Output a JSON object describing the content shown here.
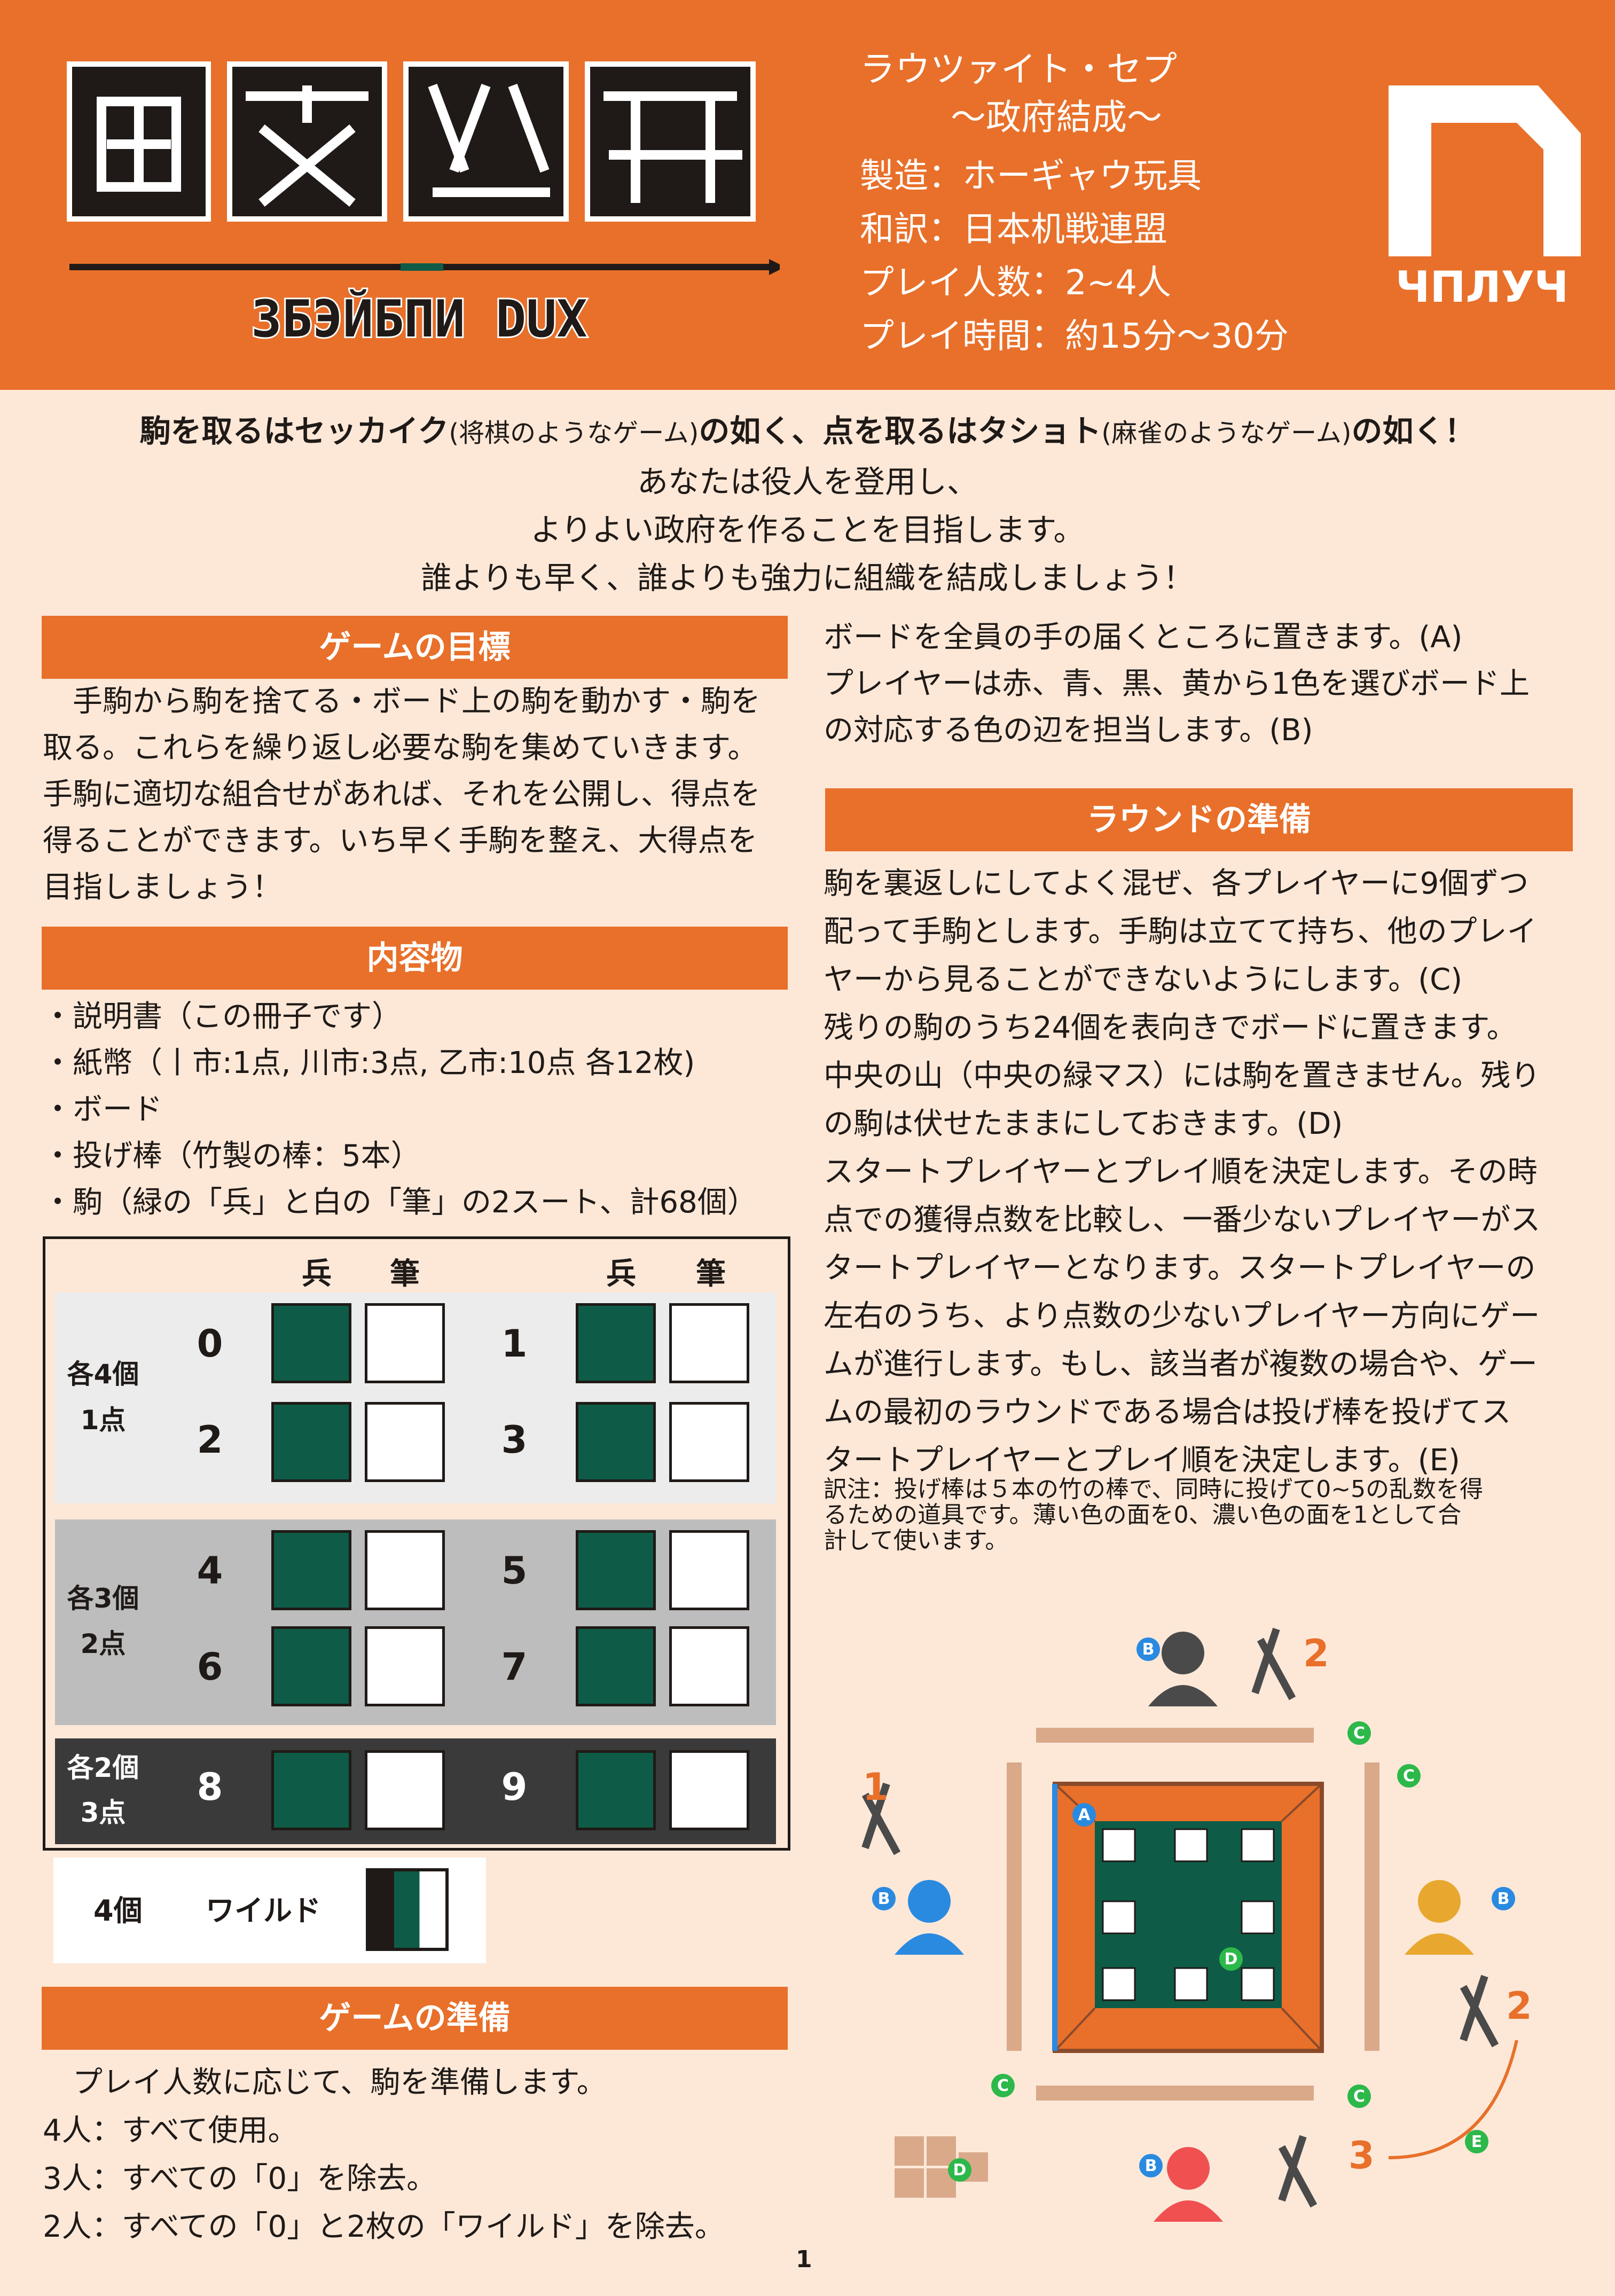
{
  "header": {
    "logo_subtitle": "ЗБЭЙБПИ DUX",
    "title_line1": "ラウツァイト・セプ",
    "title_line2": "〜政府結成〜",
    "manufacturer": "製造：ホーギャウ玩具",
    "translator": "和訳：日本机戦連盟",
    "players": "プレイ人数：2~4人",
    "playtime": "プレイ時間：約15分〜30分",
    "brand_text": "ЧΠЛУЧ"
  },
  "intro": {
    "line1_a": "駒を取るはセッカイク",
    "line1_b": "(将棋のようなゲーム)",
    "line1_c": "の如く、点を取るはタショト",
    "line1_d": "(麻雀のようなゲーム)",
    "line1_e": "の如く！",
    "line2": "あなたは役人を登用し、",
    "line3": "よりよい政府を作ることを目指します。",
    "line4": "誰よりも早く、誰よりも強力に組織を結成しましょう！"
  },
  "left": {
    "goal_title": "ゲームの目標",
    "goal_lines": [
      "　手駒から駒を捨てる・ボード上の駒を動かす・駒を",
      "取る。これらを繰り返し必要な駒を集めていきます。",
      "手駒に適切な組合せがあれば、それを公開し、得点を",
      "得ることができます。いち早く手駒を整え、大得点を",
      "目指しましょう！"
    ],
    "contents_title": "内容物",
    "contents_items": [
      "・説明書（この冊子です）",
      "・紙幣（丨市:1点, 川市:3点, 乙市:10点 各12枚)",
      "・ボード",
      "・投げ棒（竹製の棒：5本）",
      "・駒（緑の「兵」と白の「筆」の2スート、計68個）"
    ],
    "prep_title": "ゲームの準備",
    "prep_lines": [
      "　プレイ人数に応じて、駒を準備します。",
      "4人：すべて使用。",
      "3人：すべての「0」を除去。",
      "2人：すべての「0」と2枚の「ワイルド」を除去。"
    ]
  },
  "table": {
    "col_a": "兵",
    "col_b": "筆",
    "group1_count": "各4個",
    "group1_points": "1点",
    "group2_count": "各3個",
    "group2_points": "2点",
    "group3_count": "各2個",
    "group3_points": "3点",
    "numbers": [
      "0",
      "1",
      "2",
      "3",
      "4",
      "5",
      "6",
      "7",
      "8",
      "9"
    ],
    "wild_count": "4個",
    "wild_label": "ワイルド"
  },
  "right": {
    "setup_lines": [
      "ボードを全員の手の届くところに置きます。(A)",
      "プレイヤーは赤、青、黒、黄から1色を選びボード上",
      "の対応する色の辺を担当します。(B)"
    ],
    "round_title": "ラウンドの準備",
    "round_lines": [
      "駒を裏返しにしてよく混ぜ、各プレイヤーに9個ずつ",
      "配って手駒とします。手駒は立てて持ち、他のプレイ",
      "ヤーから見ることができないようにします。(C)",
      "残りの駒のうち24個を表向きでボードに置きます。",
      "中央の山（中央の緑マス）には駒を置きません。残り",
      "の駒は伏せたままにしておきます。(D)",
      "スタートプレイヤーとプレイ順を決定します。その時",
      "点での獲得点数を比較し、一番少ないプレイヤーがス",
      "タートプレイヤーとなります。スタートプレイヤーの",
      "左右のうち、より点数の少ないプレイヤー方向にゲー",
      "ムが進行します。もし、該当者が複数の場合や、ゲー",
      "ムの最初のラウンドである場合は投げ棒を投げてス",
      "タートプレイヤーとプレイ順を決定します。(E)"
    ],
    "note_lines": [
      "訳注：投げ棒は５本の竹の棒で、同時に投げて0~5の乱数を得",
      "るための道具です。薄い色の面を0、濃い色の面を1として合",
      "計して使います。"
    ]
  },
  "diagram": {
    "labels": [
      "A",
      "B",
      "C",
      "D",
      "E"
    ],
    "order": [
      "1",
      "2",
      "2",
      "3"
    ]
  },
  "colors": {
    "accent": "#e8702a",
    "green": "#0e5c47",
    "background": "#fde8d8"
  },
  "page_number": "1"
}
